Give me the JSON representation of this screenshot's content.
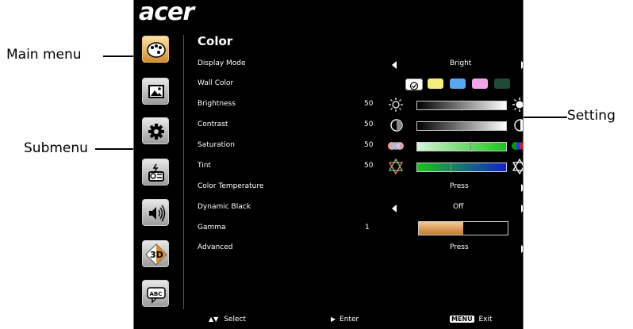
{
  "annotations": {
    "main_menu": "Main menu",
    "submenu": "Submenu",
    "setting": "Setting"
  },
  "osd": {
    "brand": "acer",
    "title": "Color",
    "main_menu_icons": [
      "palette-icon",
      "picture-icon",
      "gear-icon",
      "projector-icon",
      "speaker-icon",
      "3d-icon",
      "abc-bubble-icon"
    ],
    "rows": [
      {
        "label": "Display Mode",
        "value": "Bright"
      },
      {
        "label": "Wall Color"
      },
      {
        "label": "Brightness",
        "number": "50"
      },
      {
        "label": "Contrast",
        "number": "50"
      },
      {
        "label": "Saturation",
        "number": "50"
      },
      {
        "label": "Tint",
        "number": "50"
      },
      {
        "label": "Color Temperature",
        "value": "Press"
      },
      {
        "label": "Dynamic Black",
        "value": "Off"
      },
      {
        "label": "Gamma",
        "number": "1"
      },
      {
        "label": "Advanced",
        "value": "Press"
      }
    ],
    "wall_colors": [
      "#ffffff",
      "#f6ee7a",
      "#5aa7f0",
      "#f2a6e8",
      "#1f4a36"
    ],
    "levels": {
      "brightness": 0.5,
      "contrast": 0.5,
      "saturation": 0.6,
      "tint": 0.38,
      "gamma": 0.5
    },
    "footer": {
      "select": "Select",
      "enter": "Enter",
      "menu_key": "MENU",
      "exit": "Exit"
    }
  }
}
